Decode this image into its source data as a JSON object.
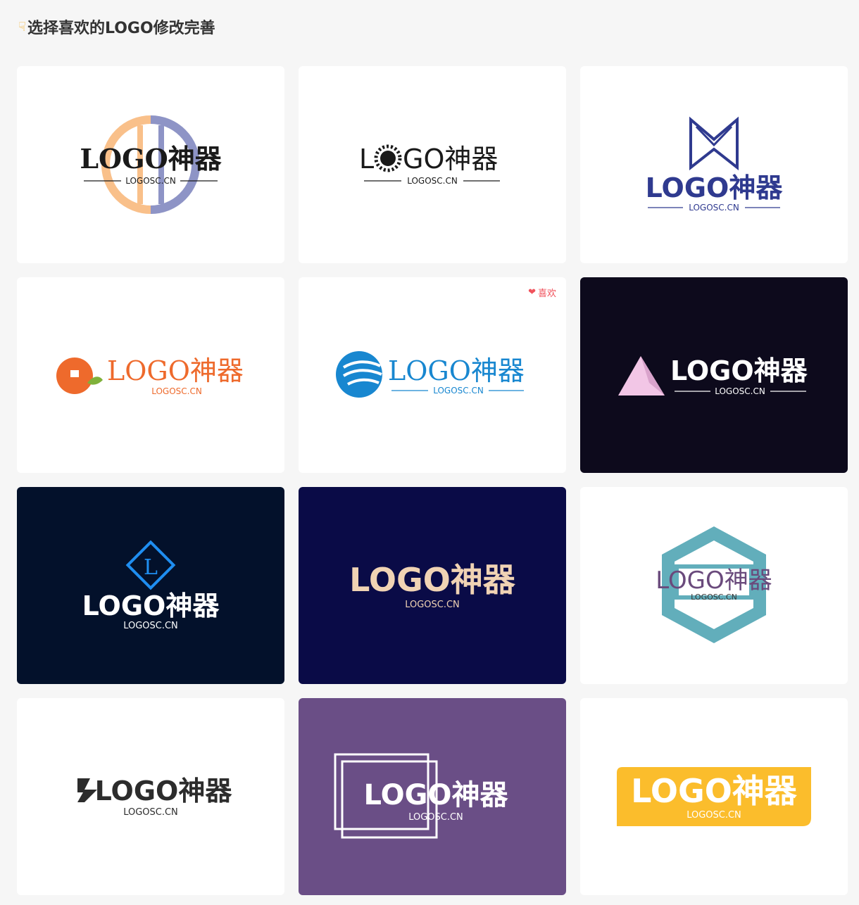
{
  "header": {
    "icon": "pointing-down-hand-icon",
    "title": "选择喜欢的LOGO修改完善"
  },
  "logos": [
    {
      "text": "LOGO神器",
      "subtitle": "LOGOSC.CN",
      "background": "#ffffff",
      "text_color": "#1a1a1a",
      "accent": "#f9c08a",
      "accent2": "#8e94c6"
    },
    {
      "text": "LOGO神器",
      "subtitle": "LOGOSC.CN",
      "background": "#ffffff",
      "text_color": "#1a1a1a",
      "accent": "#1a1a1a"
    },
    {
      "text": "LOGO神器",
      "subtitle": "LOGOSC.CN",
      "background": "#ffffff",
      "text_color": "#2f3a8f",
      "accent": "#2f3a8f"
    },
    {
      "text": "LOGO神器",
      "subtitle": "LOGOSC.CN",
      "background": "#ffffff",
      "text_color": "#ee6a2c",
      "accent": "#ee6a2c",
      "accent2": "#7fb13a"
    },
    {
      "text": "LOGO神器",
      "subtitle": "LOGOSC.CN",
      "background": "#ffffff",
      "text_color": "#1887d0",
      "accent": "#1887d0",
      "like_label": "喜欢",
      "like_icon": "heart-icon"
    },
    {
      "text": "LOGO神器",
      "subtitle": "LOGOSC.CN",
      "background": "#0d0a1c",
      "text_color": "#ffffff",
      "accent": "#f2c6e6"
    },
    {
      "text": "LOGO神器",
      "subtitle": "LOGOSC.CN",
      "background": "#03112b",
      "text_color": "#ffffff",
      "accent": "#1f8ef1"
    },
    {
      "text": "LOGO神器",
      "subtitle": "LOGOSC.CN",
      "background": "#0a0b47",
      "text_color": "#f0d3b4",
      "accent": "#f0d3b4"
    },
    {
      "text": "LOGO神器",
      "subtitle": "LOGOSC.CN",
      "background": "#ffffff",
      "text_color": "#6a4a7c",
      "accent": "#62aebb"
    },
    {
      "text": "LOGO神器",
      "subtitle": "LOGOSC.CN",
      "background": "#ffffff",
      "text_color": "#2c2c2c",
      "accent": "#2c2c2c"
    },
    {
      "text": "LOGO神器",
      "subtitle": "LOGOSC.CN",
      "background": "#6a4e86",
      "text_color": "#ffffff",
      "accent": "#ffffff"
    },
    {
      "text": "LOGO神器",
      "subtitle": "LOGOSC.CN",
      "background": "#ffffff",
      "text_color": "#ffffff",
      "accent": "#fbbd2c"
    }
  ]
}
